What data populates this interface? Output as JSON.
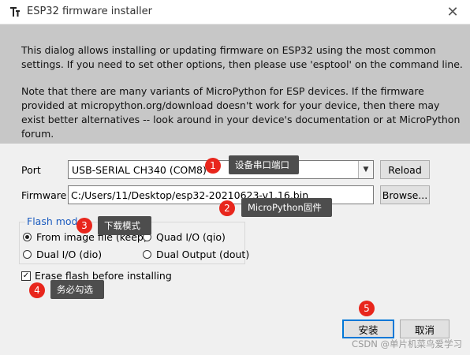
{
  "window": {
    "title": "ESP32 firmware installer",
    "app_icon": "thonny-icon",
    "close": "✕"
  },
  "info": {
    "p1": "This dialog allows installing or updating firmware on ESP32 using the most common settings. If you need to set other options, then please use 'esptool' on the command line.",
    "p2": "Note that there are many variants of MicroPython for ESP devices. If the firmware provided at micropython.org/download doesn't work for your device, then there may exist better alternatives -- look around in your device's documentation or at MicroPython forum."
  },
  "port": {
    "label": "Port",
    "value": "USB-SERIAL CH340 (COM8)",
    "reload": "Reload"
  },
  "firmware": {
    "label": "Firmware",
    "value": "C:/Users/11/Desktop/esp32-20210623-v1.16.bin",
    "browse": "Browse..."
  },
  "flash_mode": {
    "title": "Flash mode",
    "options": [
      {
        "label": "From image file (keep)",
        "selected": true
      },
      {
        "label": "Quad I/O (qio)",
        "selected": false
      },
      {
        "label": "Dual I/O (dio)",
        "selected": false
      },
      {
        "label": "Dual Output (dout)",
        "selected": false
      }
    ]
  },
  "erase": {
    "label": "Erase flash before installing",
    "checked": true
  },
  "actions": {
    "install": "安装",
    "cancel": "取消"
  },
  "annotations": [
    {
      "num": "1",
      "text": "设备串口端口"
    },
    {
      "num": "2",
      "text": "MicroPython固件"
    },
    {
      "num": "3",
      "text": "下载模式"
    },
    {
      "num": "4",
      "text": "务必勾选"
    },
    {
      "num": "5",
      "text": ""
    }
  ],
  "watermark": "CSDN @单片机菜鸟爱学习",
  "colors": {
    "badge": "#e8261c",
    "tooltip": "#4d4d4d",
    "info_bg": "#c7c7c7",
    "group_title": "#1c5cbf",
    "focus_border": "#0078d7"
  }
}
